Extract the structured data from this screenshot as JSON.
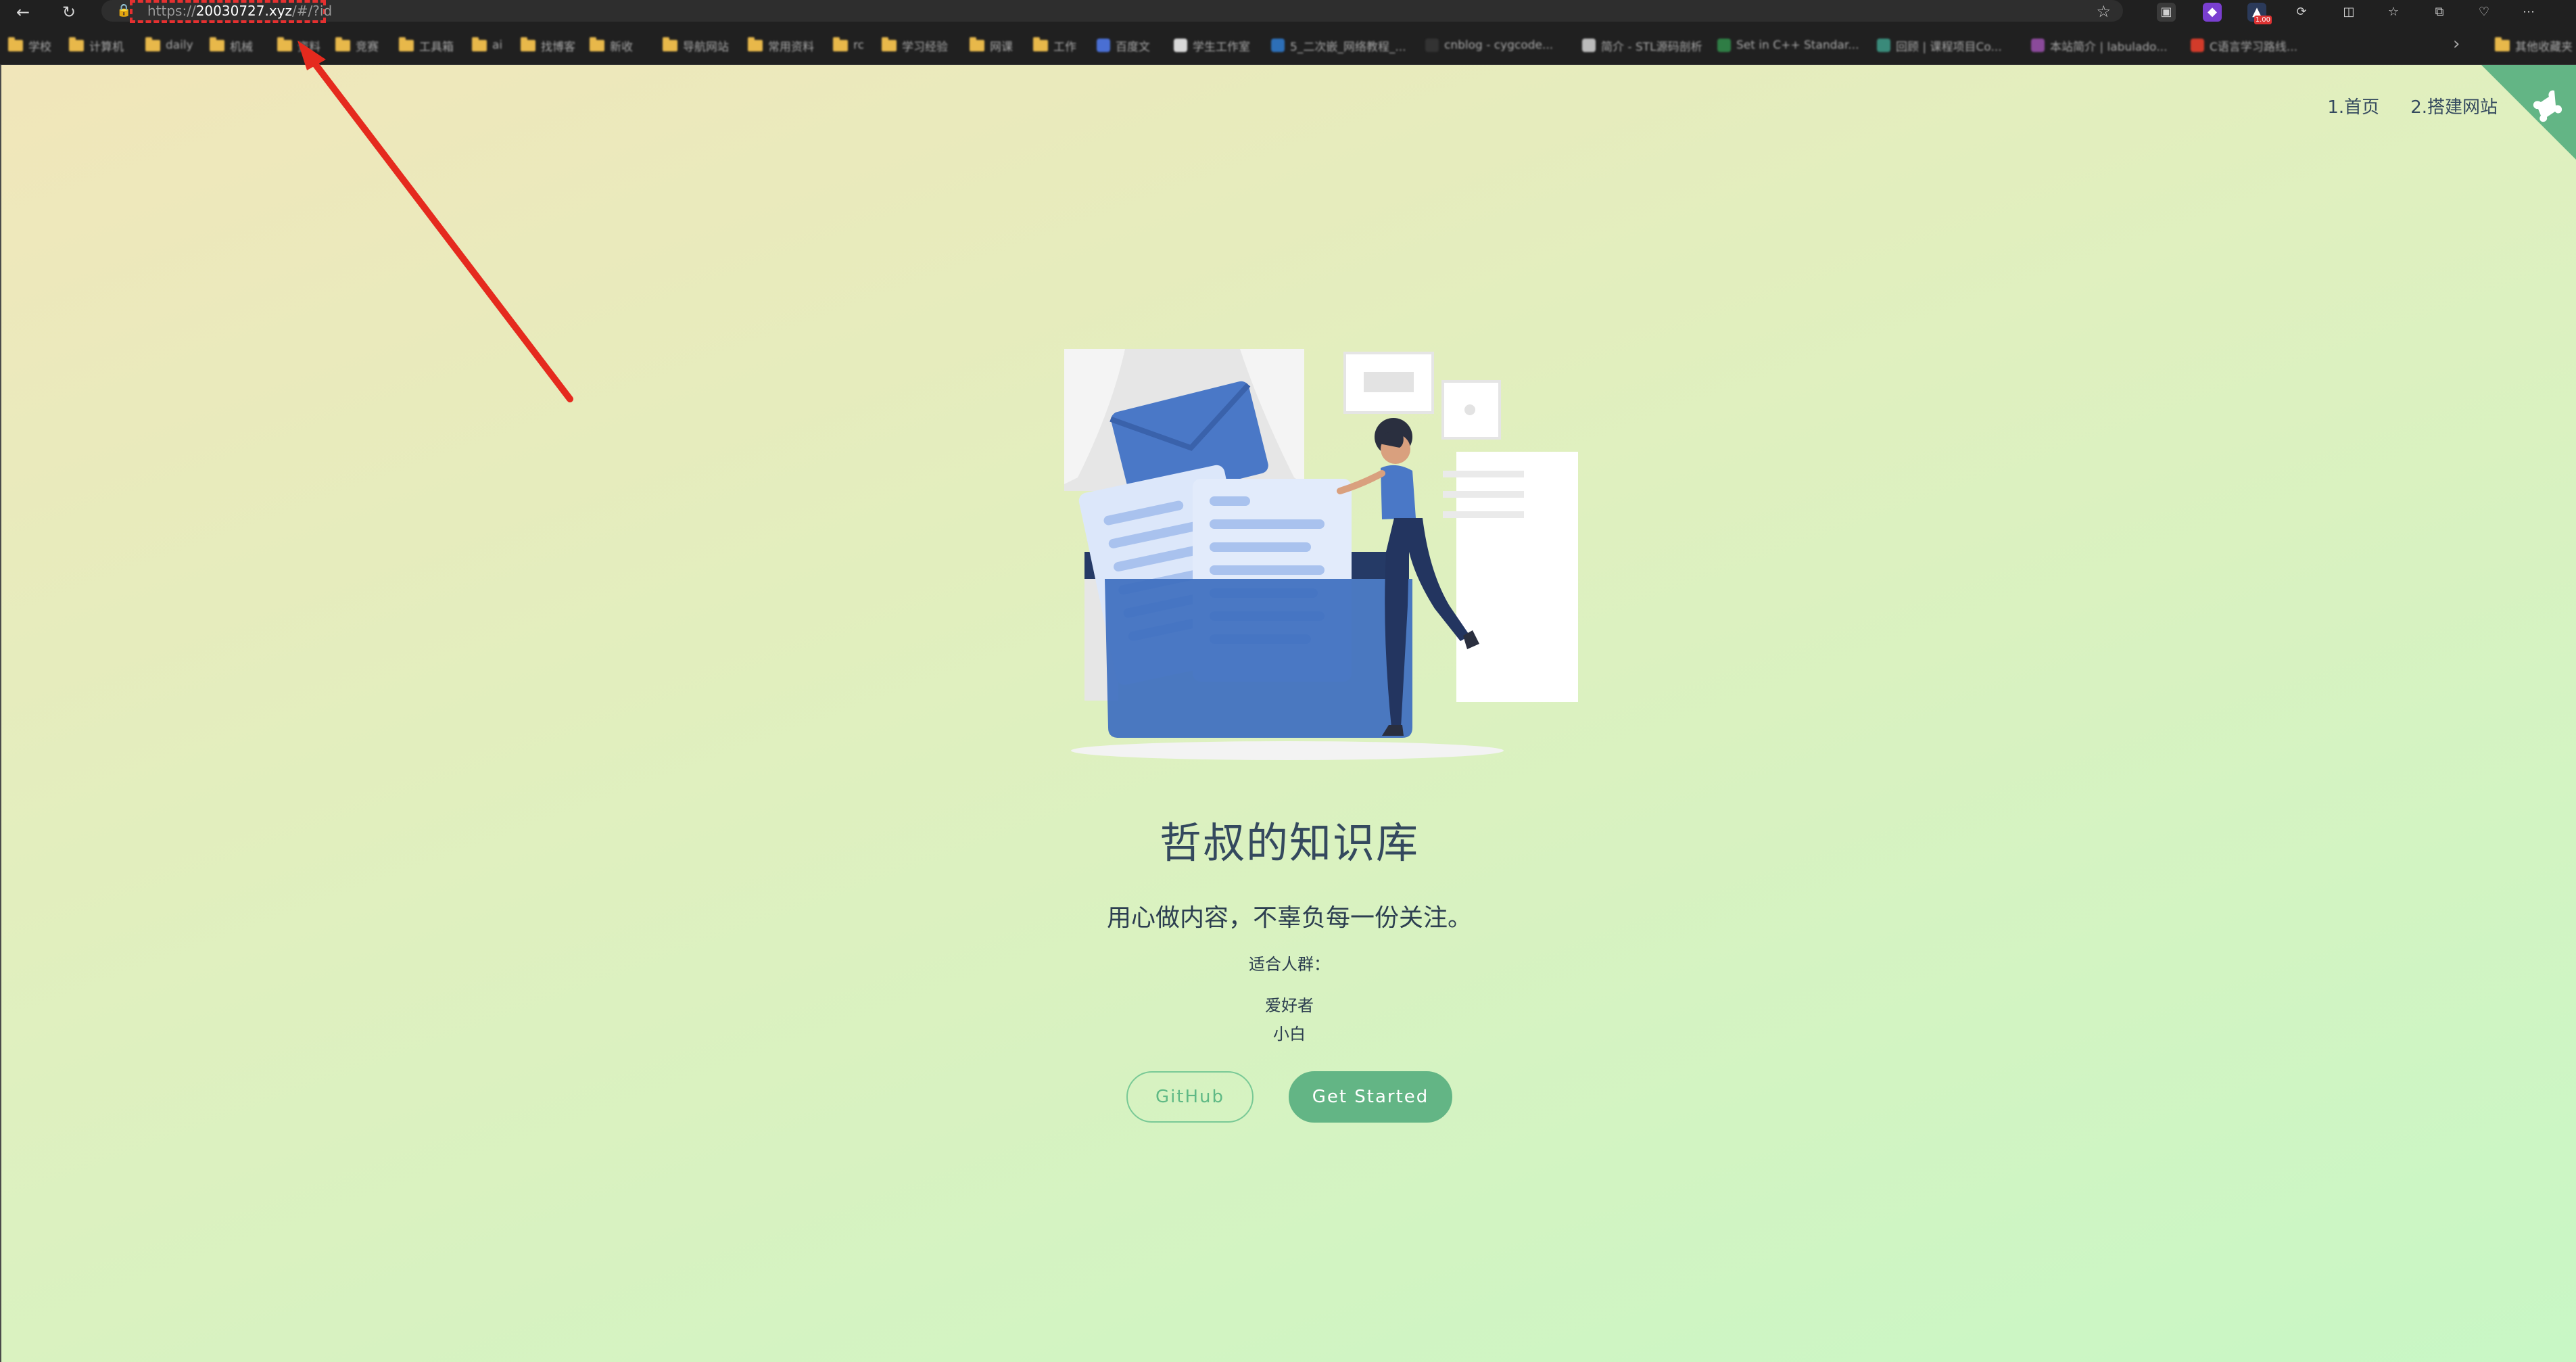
{
  "browser": {
    "url_prefix": "https://",
    "url_domain": "20030727.xyz",
    "url_suffix": "/#/?id",
    "badge": "1.00"
  },
  "bookmarks": [
    {
      "label": "学校",
      "kind": "folder"
    },
    {
      "label": "计算机",
      "kind": "folder"
    },
    {
      "label": "daily",
      "kind": "folder"
    },
    {
      "label": "机械",
      "kind": "folder"
    },
    {
      "label": "资料",
      "kind": "folder"
    },
    {
      "label": "竞赛",
      "kind": "folder"
    },
    {
      "label": "工具箱",
      "kind": "folder"
    },
    {
      "label": "ai",
      "kind": "folder"
    },
    {
      "label": "找博客",
      "kind": "folder"
    },
    {
      "label": "新收",
      "kind": "folder"
    },
    {
      "label": "导航网站",
      "kind": "folder"
    },
    {
      "label": "常用资料",
      "kind": "folder"
    },
    {
      "label": "rc",
      "kind": "folder"
    },
    {
      "label": "学习经验",
      "kind": "folder"
    },
    {
      "label": "网课",
      "kind": "folder"
    },
    {
      "label": "工作",
      "kind": "folder"
    },
    {
      "label": "百度文",
      "kind": "site",
      "color": "#4a6fd3"
    },
    {
      "label": "学生工作室",
      "kind": "site",
      "color": "#d8d8d8"
    },
    {
      "label": "5_二次嵌_网络教程_...",
      "kind": "site",
      "color": "#2d6fb7"
    },
    {
      "label": "cnblog - cygcode...",
      "kind": "site",
      "color": "#333333"
    },
    {
      "label": "简介 - STL源码剖析",
      "kind": "site",
      "color": "#bbbbbb"
    },
    {
      "label": "Set in C++ Standar...",
      "kind": "site",
      "color": "#2f7d45"
    },
    {
      "label": "回顾 | 课程项目Co...",
      "kind": "site",
      "color": "#3a8a7a"
    },
    {
      "label": "本站简介 | labulado...",
      "kind": "site",
      "color": "#8a4a9a"
    },
    {
      "label": "C语言学习路线...",
      "kind": "site",
      "color": "#d23b2a"
    }
  ],
  "bookmarks_folder_right": "其他收藏夹",
  "nav": {
    "home": "1.首页",
    "build": "2.搭建网站"
  },
  "hero": {
    "title": "哲叔的知识库",
    "subtitle": "用心做内容，不辜负每一份关注。",
    "audience_label": "适合人群：",
    "audience": [
      "爱好者",
      "小白"
    ],
    "github_button": "GitHub",
    "start_button": "Get Started"
  },
  "colors": {
    "accent": "#63b585",
    "annotation_red": "#e52a1e",
    "text": "#34495e"
  }
}
